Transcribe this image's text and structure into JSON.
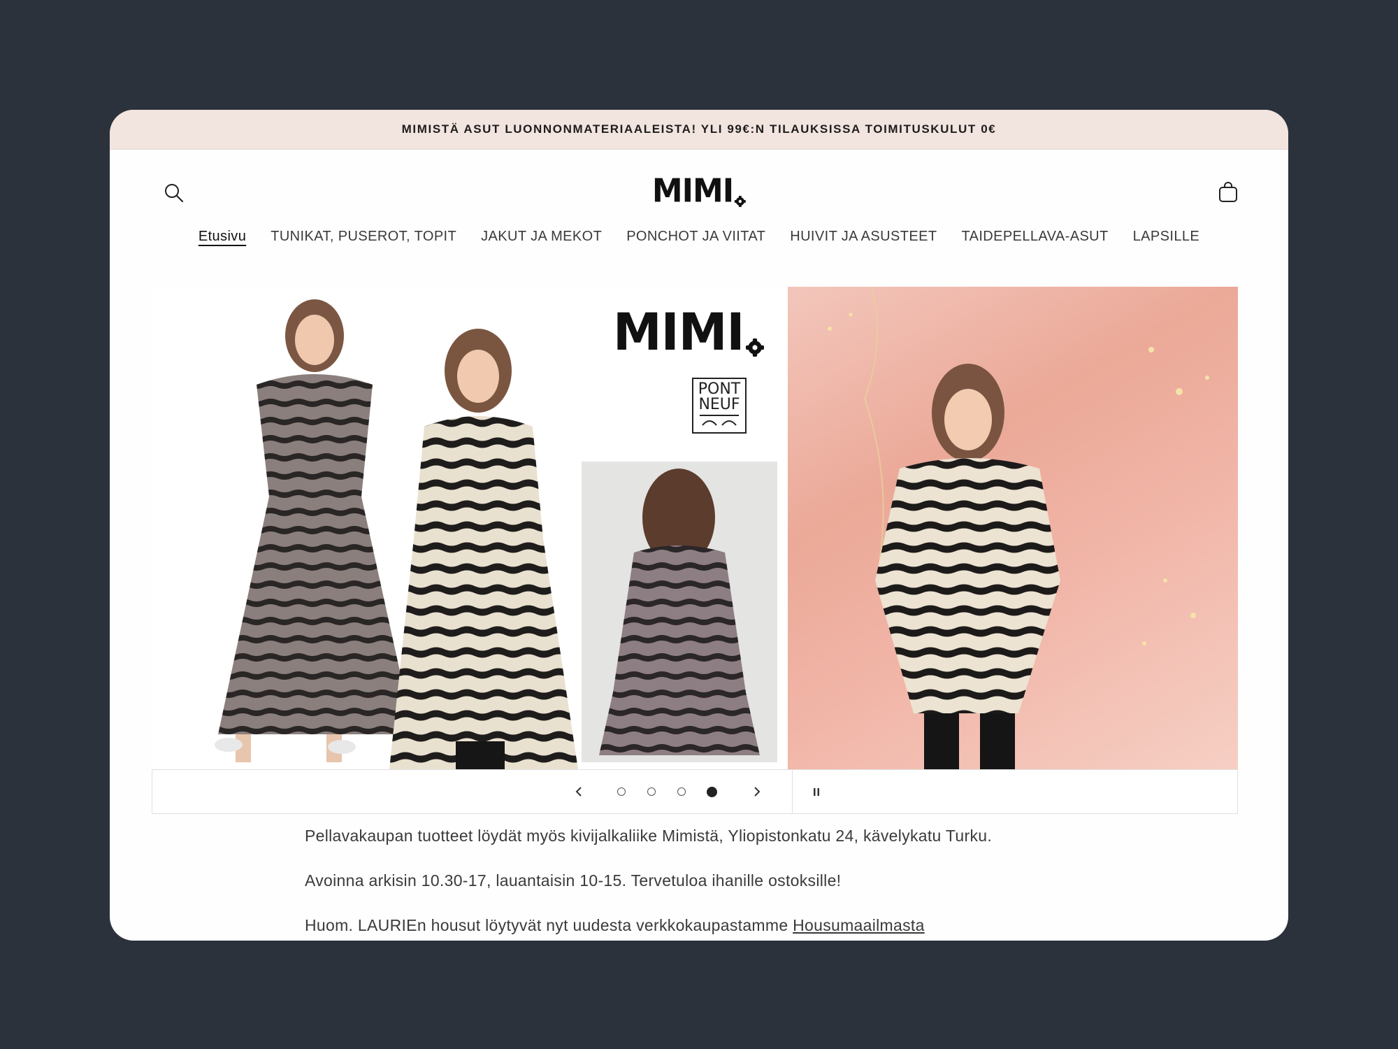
{
  "announcement": "MIMISTÄ ASUT LUONNONMATERIAALEISTA! YLI 99€:N TILAUKSISSA TOIMITUSKULUT 0€",
  "logo": "MIMI",
  "nav": [
    {
      "label": "Etusivu",
      "active": true
    },
    {
      "label": "TUNIKAT, PUSEROT, TOPIT"
    },
    {
      "label": "JAKUT JA MEKOT"
    },
    {
      "label": "PONCHOT JA VIITAT"
    },
    {
      "label": "HUIVIT JA ASUSTEET"
    },
    {
      "label": "TAIDEPELLAVA-ASUT"
    },
    {
      "label": "LAPSILLE"
    }
  ],
  "slideshow": {
    "logo": "MIMI",
    "brand_box": [
      "PONT",
      "NEUF"
    ],
    "slide_count": 4,
    "active_slide": 4
  },
  "content": {
    "p1": "Pellavakaupan tuotteet löydät myös kivijalkaliike Mimistä, Yliopistonkatu 24, kävelykatu Turku.",
    "p2": "Avoinna arkisin 10.30-17, lauantaisin 10-15. Tervetuloa ihanille ostoksille!",
    "p3_prefix": "Huom. LAURIEn housut löytyvät nyt uudesta verkkokaupastamme ",
    "p3_link": "Housumaailmasta"
  },
  "colors": {
    "page_bg": "#2b323b",
    "announcement_bg": "#f2e4de",
    "text": "#3a3a3a"
  }
}
